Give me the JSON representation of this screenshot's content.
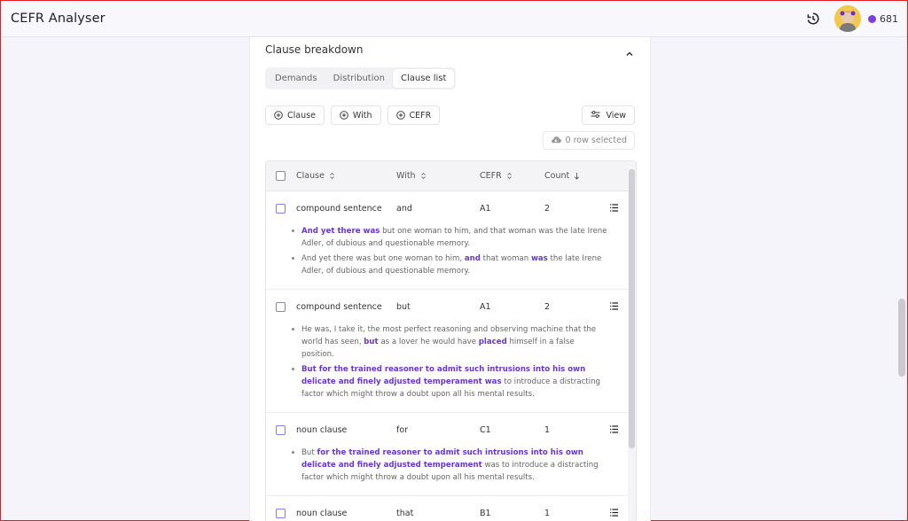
{
  "header": {
    "title": "CEFR Analyser",
    "coins": "681",
    "history_icon": "history-icon",
    "avatar": "avatar"
  },
  "section": {
    "title": "Clause breakdown"
  },
  "tabs": [
    {
      "label": "Demands",
      "active": false
    },
    {
      "label": "Distribution",
      "active": false
    },
    {
      "label": "Clause list",
      "active": true
    }
  ],
  "filters": {
    "clause": "Clause",
    "with": "With",
    "cefr": "CEFR",
    "view": "View",
    "rows_selected": "0 row selected"
  },
  "table": {
    "columns": [
      "Clause",
      "With",
      "CEFR",
      "Count"
    ],
    "rows": [
      {
        "clause": "compound sentence",
        "with": "and",
        "cefr": "A1",
        "count": "2",
        "examples": [
          [
            {
              "t": "And yet there was",
              "h": true
            },
            {
              "t": " but one woman to him, and that woman was the late Irene Adler, of dubious and questionable memory.",
              "h": false
            }
          ],
          [
            {
              "t": "And yet there was but one woman to him, ",
              "h": false
            },
            {
              "t": "and",
              "h": true
            },
            {
              "t": " that woman ",
              "h": false
            },
            {
              "t": "was",
              "h": true
            },
            {
              "t": " the late Irene Adler, of dubious and questionable memory.",
              "h": false
            }
          ]
        ]
      },
      {
        "clause": "compound sentence",
        "with": "but",
        "cefr": "A1",
        "count": "2",
        "examples": [
          [
            {
              "t": "He was, I take it, the most perfect reasoning and observing machine that the world has seen, ",
              "h": false
            },
            {
              "t": "but",
              "h": true
            },
            {
              "t": " as a lover he would have ",
              "h": false
            },
            {
              "t": "placed",
              "h": true
            },
            {
              "t": " himself in a false position.",
              "h": false
            }
          ],
          [
            {
              "t": "But for the trained reasoner to admit such intrusions into his own delicate and finely adjusted temperament was",
              "h": true
            },
            {
              "t": " to introduce a distracting factor which might throw a doubt upon all his mental results.",
              "h": false
            }
          ]
        ]
      },
      {
        "clause": "noun clause",
        "with": "for",
        "cefr": "C1",
        "count": "1",
        "examples": [
          [
            {
              "t": "But ",
              "h": false
            },
            {
              "t": "for the trained reasoner to admit such intrusions into his own delicate and finely adjusted temperament",
              "h": true
            },
            {
              "t": " was to introduce a distracting factor which might throw a doubt upon all his mental results.",
              "h": false
            }
          ]
        ]
      },
      {
        "clause": "noun clause",
        "with": "that",
        "cefr": "B1",
        "count": "1",
        "examples": []
      }
    ]
  }
}
